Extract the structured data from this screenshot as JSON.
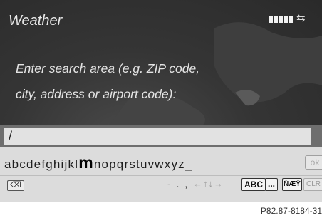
{
  "header": {
    "title": "Weather",
    "swap_icon": "swap-arrows-icon"
  },
  "prompt": {
    "line1": "Enter search area (e.g. ZIP code,",
    "line2": "city, address or airport code):"
  },
  "input": {
    "value": "/"
  },
  "keyboard": {
    "letters_before": "abcdefghijkl",
    "selected": "m",
    "letters_after": "nopqrstuvwxyz_",
    "ok_label": "ok",
    "backspace_symbol": "⌫",
    "punctuation": "- . ,",
    "arrows": "←↑↓→",
    "abc_label": "ABC",
    "more_label": "...",
    "lang_label": "ÑÆŸ",
    "clr_label": "CLR"
  },
  "caption": "P82.87-8184-31"
}
